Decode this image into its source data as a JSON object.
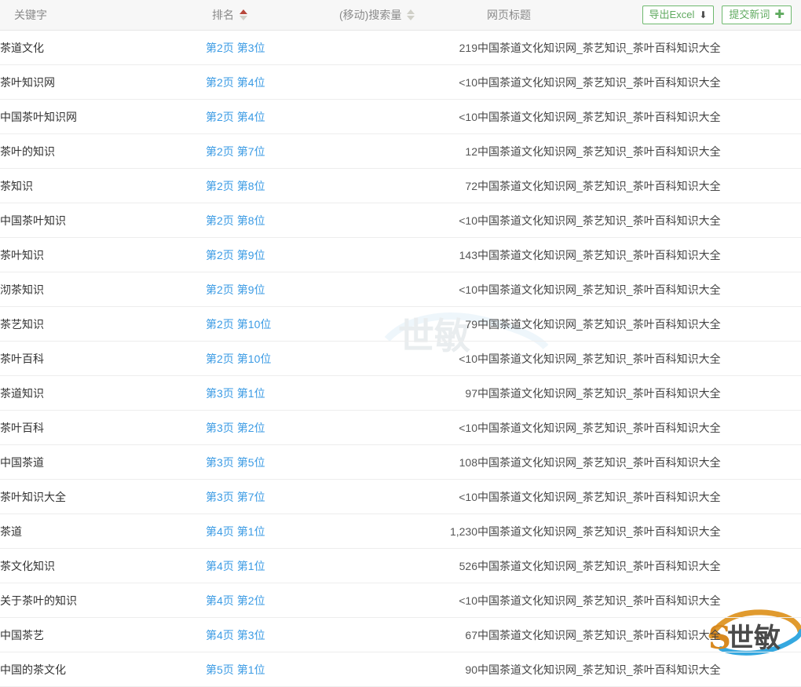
{
  "header": {
    "columns": {
      "keyword": "关键字",
      "rank": "排名",
      "volume": "(移动)搜索量",
      "page_title": "网页标题"
    },
    "sort": {
      "rank_active_direction": "asc",
      "volume_active_direction": "none"
    },
    "buttons": {
      "export_excel": "导出Excel",
      "export_excel_icon": "download-icon",
      "export_excel_glyph": "⬇",
      "submit_keyword": "提交新词",
      "submit_keyword_icon": "plus-icon",
      "submit_keyword_glyph": "✚"
    },
    "colors": {
      "button_border": "#6eb96e",
      "button_text": "#5faa5f",
      "link_blue": "#3b9be4",
      "sort_active": "#b7483c",
      "header_bg": "#f7f7f7"
    }
  },
  "watermark": {
    "center_text": "世敏",
    "corner_text": "S世敏",
    "corner_letter": "S"
  },
  "rows": [
    {
      "keyword": "茶道文化",
      "rank_page": "第2页",
      "rank_pos": "第3位",
      "volume": "219",
      "title": "中国茶道文化知识网_茶艺知识_茶叶百科知识大全"
    },
    {
      "keyword": "茶叶知识网",
      "rank_page": "第2页",
      "rank_pos": "第4位",
      "volume": "<10",
      "title": "中国茶道文化知识网_茶艺知识_茶叶百科知识大全"
    },
    {
      "keyword": "中国茶叶知识网",
      "rank_page": "第2页",
      "rank_pos": "第4位",
      "volume": "<10",
      "title": "中国茶道文化知识网_茶艺知识_茶叶百科知识大全"
    },
    {
      "keyword": "茶叶的知识",
      "rank_page": "第2页",
      "rank_pos": "第7位",
      "volume": "12",
      "title": "中国茶道文化知识网_茶艺知识_茶叶百科知识大全"
    },
    {
      "keyword": "茶知识",
      "rank_page": "第2页",
      "rank_pos": "第8位",
      "volume": "72",
      "title": "中国茶道文化知识网_茶艺知识_茶叶百科知识大全"
    },
    {
      "keyword": "中国茶叶知识",
      "rank_page": "第2页",
      "rank_pos": "第8位",
      "volume": "<10",
      "title": "中国茶道文化知识网_茶艺知识_茶叶百科知识大全"
    },
    {
      "keyword": "茶叶知识",
      "rank_page": "第2页",
      "rank_pos": "第9位",
      "volume": "143",
      "title": "中国茶道文化知识网_茶艺知识_茶叶百科知识大全"
    },
    {
      "keyword": "沏茶知识",
      "rank_page": "第2页",
      "rank_pos": "第9位",
      "volume": "<10",
      "title": "中国茶道文化知识网_茶艺知识_茶叶百科知识大全"
    },
    {
      "keyword": "茶艺知识",
      "rank_page": "第2页",
      "rank_pos": "第10位",
      "volume": "79",
      "title": "中国茶道文化知识网_茶艺知识_茶叶百科知识大全"
    },
    {
      "keyword": "茶叶百科",
      "rank_page": "第2页",
      "rank_pos": "第10位",
      "volume": "<10",
      "title": "中国茶道文化知识网_茶艺知识_茶叶百科知识大全"
    },
    {
      "keyword": "茶道知识",
      "rank_page": "第3页",
      "rank_pos": "第1位",
      "volume": "97",
      "title": "中国茶道文化知识网_茶艺知识_茶叶百科知识大全"
    },
    {
      "keyword": "茶叶百科",
      "rank_page": "第3页",
      "rank_pos": "第2位",
      "volume": "<10",
      "title": "中国茶道文化知识网_茶艺知识_茶叶百科知识大全"
    },
    {
      "keyword": "中国茶道",
      "rank_page": "第3页",
      "rank_pos": "第5位",
      "volume": "108",
      "title": "中国茶道文化知识网_茶艺知识_茶叶百科知识大全"
    },
    {
      "keyword": "茶叶知识大全",
      "rank_page": "第3页",
      "rank_pos": "第7位",
      "volume": "<10",
      "title": "中国茶道文化知识网_茶艺知识_茶叶百科知识大全"
    },
    {
      "keyword": "茶道",
      "rank_page": "第4页",
      "rank_pos": "第1位",
      "volume": "1,230",
      "title": "中国茶道文化知识网_茶艺知识_茶叶百科知识大全"
    },
    {
      "keyword": "茶文化知识",
      "rank_page": "第4页",
      "rank_pos": "第1位",
      "volume": "526",
      "title": "中国茶道文化知识网_茶艺知识_茶叶百科知识大全"
    },
    {
      "keyword": "关于茶叶的知识",
      "rank_page": "第4页",
      "rank_pos": "第2位",
      "volume": "<10",
      "title": "中国茶道文化知识网_茶艺知识_茶叶百科知识大全"
    },
    {
      "keyword": "中国茶艺",
      "rank_page": "第4页",
      "rank_pos": "第3位",
      "volume": "67",
      "title": "中国茶道文化知识网_茶艺知识_茶叶百科知识大全"
    },
    {
      "keyword": "中国的茶文化",
      "rank_page": "第5页",
      "rank_pos": "第1位",
      "volume": "90",
      "title": "中国茶道文化知识网_茶艺知识_茶叶百科知识大全"
    }
  ]
}
